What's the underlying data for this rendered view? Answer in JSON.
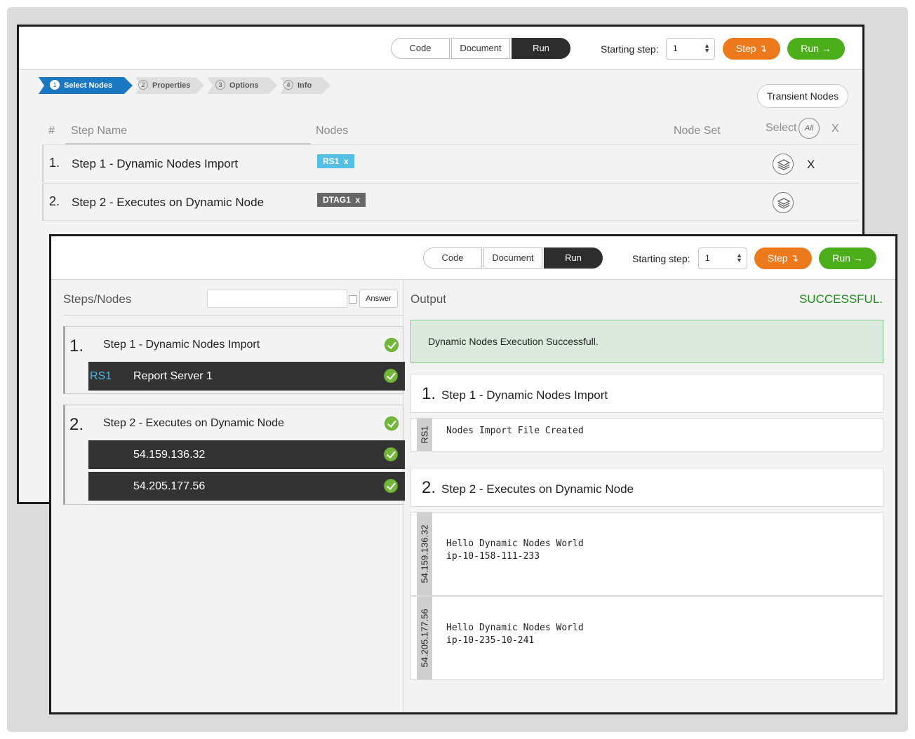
{
  "toolbar": {
    "code_label": "Code",
    "document_label": "Document",
    "run_tab_label": "Run",
    "starting_step_label": "Starting step:",
    "starting_step_value": "1",
    "step_button": "Step ↴",
    "run_button": "Run →"
  },
  "wizard": {
    "steps": [
      {
        "num": "1",
        "label": "Select Nodes"
      },
      {
        "num": "2",
        "label": "Properties"
      },
      {
        "num": "3",
        "label": "Options"
      },
      {
        "num": "4",
        "label": "Info"
      }
    ]
  },
  "editor": {
    "transient_nodes_button": "Transient Nodes",
    "columns": {
      "hash": "#",
      "step_name": "Step Name",
      "nodes": "Nodes",
      "node_set": "Node Set",
      "select": "Select",
      "all": "All",
      "clear": "X"
    },
    "rows": [
      {
        "index": "1.",
        "name": "Step 1 - Dynamic Nodes Import",
        "tag": "RS1",
        "tag_x": "x",
        "remove": "X"
      },
      {
        "index": "2.",
        "name": "Step 2 - Executes on Dynamic Node",
        "tag": "DTAG1",
        "tag_x": "x"
      }
    ]
  },
  "runner": {
    "steps_nodes_title": "Steps/Nodes",
    "answer_button": "Answer",
    "output_title": "Output",
    "status": "SUCCESSFUL.",
    "success_message": "Dynamic Nodes Execution Successfull.",
    "groups": [
      {
        "index": "1.",
        "name": "Step 1 - Dynamic Nodes Import",
        "nodes": [
          {
            "id": "RS1",
            "name": "Report Server 1"
          }
        ]
      },
      {
        "index": "2.",
        "name": "Step 2 - Executes on Dynamic Node",
        "nodes": [
          {
            "id": "",
            "name": "54.159.136.32"
          },
          {
            "id": "",
            "name": "54.205.177.56"
          }
        ]
      }
    ],
    "outputs": [
      {
        "index": "1.",
        "name": "Step 1 - Dynamic Nodes Import",
        "blocks": [
          {
            "node": "RS1",
            "text": "Nodes Import File Created"
          }
        ]
      },
      {
        "index": "2.",
        "name": "Step 2 - Executes on Dynamic Node",
        "blocks": [
          {
            "node": "54.159.136.32",
            "text": "Hello Dynamic Nodes World\nip-10-158-111-233"
          },
          {
            "node": "54.205.177.56",
            "text": "Hello Dynamic Nodes World\nip-10-235-10-241"
          }
        ]
      }
    ]
  },
  "colors": {
    "accent_blue": "#1a78c2",
    "step_orange": "#ec7a1c",
    "run_green": "#4cae1a",
    "success_green": "#1e8a1e",
    "tag_cyan": "#54c0e6"
  }
}
